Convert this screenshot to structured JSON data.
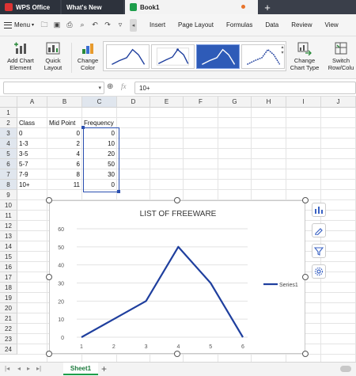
{
  "titlebar": {
    "tabs": [
      {
        "label": "WPS Office"
      },
      {
        "label": "What's New"
      },
      {
        "label": "Book1"
      }
    ],
    "add_tab": "+"
  },
  "menu": {
    "menu_label": "Menu",
    "tabs": [
      "Insert",
      "Page Layout",
      "Formulas",
      "Data",
      "Review",
      "View"
    ]
  },
  "ribbon": {
    "add_chart_element": "Add Chart Element",
    "quick_layout": "Quick Layout",
    "change_color": "Change Color",
    "change_chart_type": "Change Chart Type",
    "switch_row_column": "Switch Row/Colu"
  },
  "formula_bar": {
    "fx": "fx",
    "value": "10+"
  },
  "columns": [
    "A",
    "B",
    "C",
    "D",
    "E",
    "F",
    "G",
    "H",
    "I",
    "J"
  ],
  "rows": [
    "1",
    "2",
    "3",
    "4",
    "5",
    "6",
    "7",
    "8",
    "9",
    "10",
    "11",
    "12",
    "13",
    "14",
    "15",
    "16",
    "17",
    "18",
    "19",
    "20",
    "21",
    "22",
    "23",
    "24"
  ],
  "table": {
    "headers": [
      "Class",
      "Mid Point",
      "Frequency"
    ],
    "rows": [
      [
        "0",
        "0",
        "0"
      ],
      [
        "1-3",
        "2",
        "10"
      ],
      [
        "3-5",
        "4",
        "20"
      ],
      [
        "5-7",
        "6",
        "50"
      ],
      [
        "7-9",
        "8",
        "30"
      ],
      [
        "10+",
        "11",
        "0"
      ]
    ]
  },
  "chart_data": {
    "type": "line",
    "title": "LIST OF FREEWARE",
    "categories": [
      "1",
      "2",
      "3",
      "4",
      "5",
      "6"
    ],
    "series": [
      {
        "name": "Series1",
        "values": [
          0,
          10,
          20,
          50,
          30,
          0
        ],
        "color": "#1f3f9e"
      }
    ],
    "ylim": [
      0,
      60
    ],
    "yticks": [
      "0",
      "10",
      "20",
      "30",
      "40",
      "50",
      "60"
    ],
    "grid": true,
    "legend": "right"
  },
  "sheets": {
    "active": "Sheet1",
    "add": "+"
  }
}
